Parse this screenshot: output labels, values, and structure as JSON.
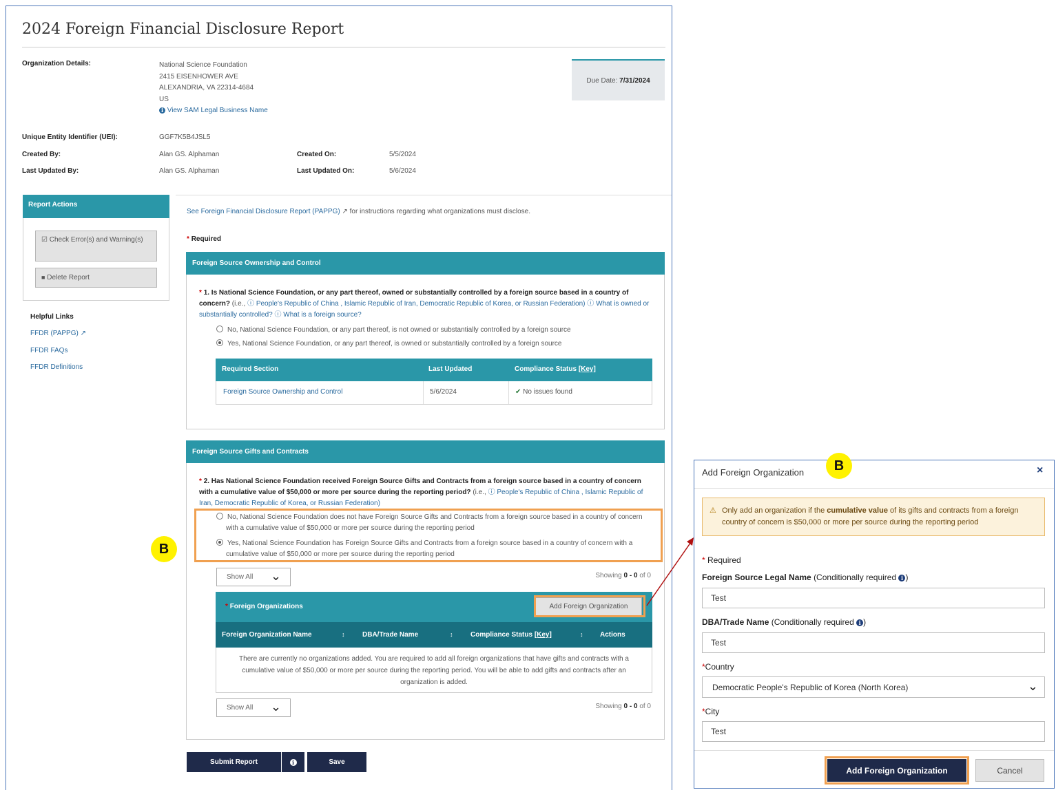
{
  "page": {
    "title": "2024 Foreign Financial Disclosure Report",
    "org_label": "Organization Details:",
    "org_lines": [
      "National Science Foundation",
      "2415 EISENHOWER AVE",
      "ALEXANDRIA, VA 22314-4684",
      "US"
    ],
    "sam_link": "View SAM Legal Business Name",
    "due_label": "Due Date:",
    "due_value": "7/31/2024",
    "uei_label": "Unique Entity Identifier (UEI):",
    "uei_value": "GGF7K5B4JSL5",
    "created_by_label": "Created By:",
    "created_by_value": "Alan GS. Alphaman",
    "created_on_label": "Created On:",
    "created_on_value": "5/5/2024",
    "updated_by_label": "Last Updated By:",
    "updated_by_value": "Alan GS. Alphaman",
    "updated_on_label": "Last Updated On:",
    "updated_on_value": "5/6/2024"
  },
  "sidebar": {
    "header": "Report Actions",
    "check_errors": "Check Error(s) and Warning(s)",
    "delete_report": "Delete Report",
    "helpful_links_title": "Helpful Links",
    "links": [
      "FFDR (PAPPG)",
      "FFDR FAQs",
      "FFDR Definitions"
    ]
  },
  "content": {
    "intro": "See Foreign Financial Disclosure Report (PAPPG)",
    "intro_rest": "for instructions regarding what organizations must disclose.",
    "required": "Required",
    "section1": {
      "header": "Foreign Source Ownership and Control",
      "q_bold": "1. Is National Science Foundation, or any part thereof, owned or substantially controlled by a foreign source based in a country of concern?",
      "q_ie": "(i.e.,",
      "q_link1": "People's Republic of China , Islamic Republic of Iran, Democratic Republic of Korea, or Russian Federation)",
      "q_link2": "What is owned or substantially controlled?",
      "q_link3": "What is a foreign source?",
      "opt_no": "No, National Science Foundation, or any part thereof, is not owned or substantially controlled by a foreign source",
      "opt_yes": "Yes, National Science Foundation, or any part thereof, is owned or substantially controlled by a foreign source",
      "table_headers": [
        "Required Section",
        "Last Updated",
        "Compliance Status"
      ],
      "key_link": "[Key]",
      "row": {
        "section": "Foreign Source Ownership and Control",
        "updated": "5/6/2024",
        "status": "No issues found"
      }
    },
    "section2": {
      "header": "Foreign Source Gifts and Contracts",
      "q_bold": "2. Has National Science Foundation received Foreign Source Gifts and Contracts from a foreign source based in a country of concern with a cumulative value of $50,000 or more per source during the reporting period?",
      "q_ie": "(i.e.,",
      "q_link1": "People's Republic of China , Islamic Republic of Iran, Democratic Republic of Korea, or Russian Federation)",
      "opt_no": "No, National Science Foundation does not have Foreign Source Gifts and Contracts from a foreign source based in a country of concern with a cumulative value of $50,000 or more per source during the reporting period",
      "opt_yes": "Yes, National Science Foundation has Foreign Source Gifts and Contracts from a foreign source based in a country of concern with a cumulative value of $50,000 or more per source during the reporting period",
      "show_all": "Show All",
      "showing_prefix": "Showing",
      "showing_range": "0 - 0",
      "showing_suffix": "of 0",
      "orgs_header": "Foreign Organizations",
      "add_org_btn": "Add Foreign Organization",
      "col_headers": [
        "Foreign Organization Name",
        "DBA/Trade Name",
        "Compliance Status",
        "Actions"
      ],
      "key_link": "[Key]",
      "empty_msg": "There are currently no organizations added. You are required to add all foreign organizations that have gifts and contracts with a cumulative value of $50,000 or more per source during the reporting period. You will be able to add gifts and contracts after an organization is added."
    },
    "submit_btn": "Submit Report",
    "save_btn": "Save"
  },
  "badges": {
    "left": "B",
    "modal": "B"
  },
  "modal": {
    "title": "Add Foreign Organization",
    "warning_pre": "Only add an organization if the",
    "warning_bold": "cumulative value",
    "warning_post": "of its gifts and contracts from a foreign country of concern is $50,000 or more per source during the reporting period",
    "required": "Required",
    "legal_name_label": "Foreign Source Legal Name",
    "cond_required": "(Conditionally required",
    "legal_name_value": "Test",
    "dba_label": "DBA/Trade Name",
    "dba_value": "Test",
    "country_label": "Country",
    "country_value": "Democratic People's Republic of Korea (North Korea)",
    "city_label": "City",
    "city_value": "Test",
    "add_btn": "Add Foreign Organization",
    "cancel_btn": "Cancel"
  },
  "colors": {
    "teal": "#2a97a8",
    "dark_teal": "#186f80",
    "navy": "#1f2a4a",
    "orange": "#f0a050",
    "yellow": "#fff200",
    "arrow": "#b01010"
  }
}
